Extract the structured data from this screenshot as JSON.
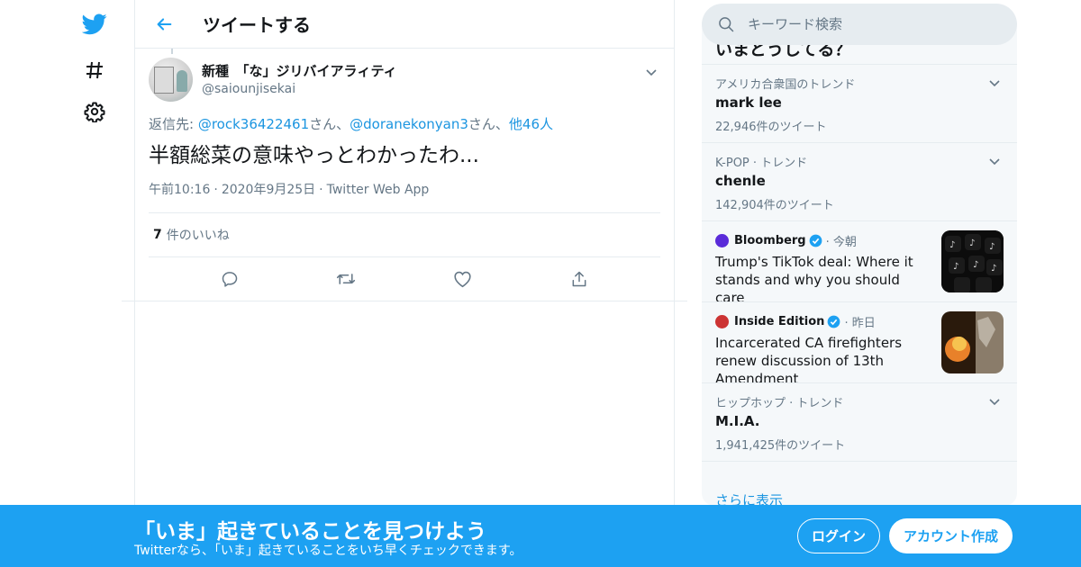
{
  "nav": {
    "icons": [
      "twitter-bird-icon",
      "hashtag-icon",
      "settings-gear-icon"
    ]
  },
  "header": {
    "title": "ツイートする"
  },
  "tweet": {
    "display_name": "新種　「な」ジリバイアラィティ",
    "handle": "@saiounjisekai",
    "reply_prefix": "返信先: ",
    "reply_mentions": [
      "@rock36422461",
      "@doranekonyan3"
    ],
    "reply_suffix_1": "さん、",
    "reply_suffix_2": "さん、",
    "reply_others": "他46人",
    "text": "半額総菜の意味やっとわかったわ...",
    "time": "午前10:16",
    "date": "2020年9月25日",
    "client": "Twitter Web App",
    "likes_count": "7",
    "likes_label": "件のいいね"
  },
  "search": {
    "placeholder": "キーワード検索"
  },
  "trends": {
    "title": "いまどうしてる？",
    "items": [
      {
        "context": "アメリカ合衆国のトレンド",
        "name": "mark lee",
        "count": "22,946件のツイート"
      },
      {
        "context": "K-POP · トレンド",
        "name": "chenle",
        "count": "142,904件のツイート"
      },
      {
        "source": "Bloomberg",
        "ago": "· 今朝",
        "title": "Trump's TikTok deal: Where it stands and why you should care"
      },
      {
        "source": "Inside Edition",
        "ago": "· 昨日",
        "title": "Incarcerated CA firefighters renew discussion of 13th Amendment"
      },
      {
        "context": "ヒップホップ · トレンド",
        "name": "M.I.A.",
        "count": "1,941,425件のツイート"
      }
    ],
    "show_more": "さらに表示"
  },
  "banner": {
    "title": "「いま」起きていることを見つけよう",
    "subtitle": "Twitterなら、「いま」起きていることをいち早くチェックできます。",
    "login": "ログイン",
    "signup": "アカウント作成"
  },
  "colors": {
    "accent": "#1da1f2",
    "link": "#1b95e0",
    "muted": "#657786"
  }
}
